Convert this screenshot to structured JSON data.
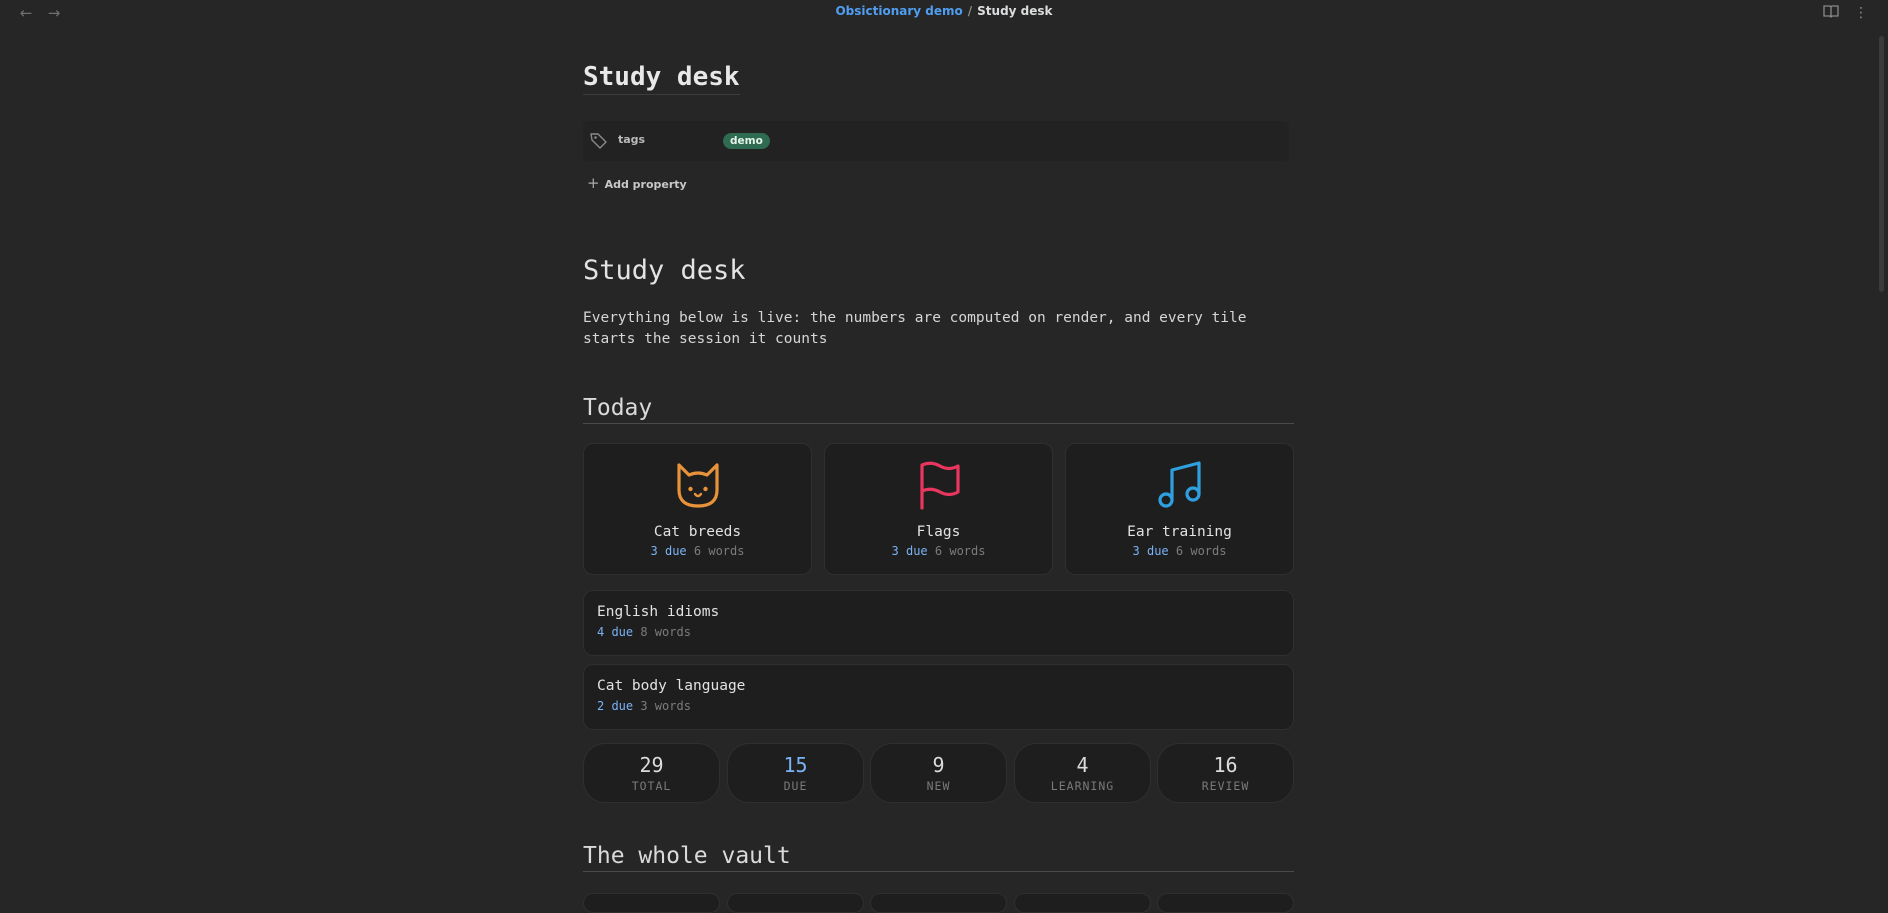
{
  "topbar": {
    "vault_name": "Obsictionary demo",
    "separator": "/",
    "current_note": "Study desk",
    "back_glyph": "←",
    "forward_glyph": "→",
    "reading_mode_glyph": "📖",
    "more_glyph": "⋮"
  },
  "note": {
    "title": "Study desk",
    "properties": [
      {
        "key": "tags",
        "value": "demo"
      }
    ],
    "add_property_label": "Add property",
    "heading": "Study desk",
    "intro": "Everything below is live: the numbers are computed on render, and every tile starts the session it counts"
  },
  "today": {
    "heading": "Today",
    "tiles": [
      {
        "name": "Cat breeds",
        "due": "3 due",
        "words": "6 words",
        "icon": "cat-icon",
        "color": "#e8923a"
      },
      {
        "name": "Flags",
        "due": "3 due",
        "words": "6 words",
        "icon": "flag-icon",
        "color": "#e8365f"
      },
      {
        "name": "Ear training",
        "due": "3 due",
        "words": "6 words",
        "icon": "music-note-icon",
        "color": "#2ea0e0"
      }
    ],
    "rows": [
      {
        "name": "English idioms",
        "due": "4 due",
        "words": "8 words"
      },
      {
        "name": "Cat body language",
        "due": "2 due",
        "words": "3 words"
      }
    ],
    "summary": [
      {
        "value": "29",
        "label": "TOTAL"
      },
      {
        "value": "15",
        "label": "DUE"
      },
      {
        "value": "9",
        "label": "NEW"
      },
      {
        "value": "4",
        "label": "LEARNING"
      },
      {
        "value": "16",
        "label": "REVIEW"
      }
    ]
  },
  "vault": {
    "heading": "The whole vault"
  }
}
